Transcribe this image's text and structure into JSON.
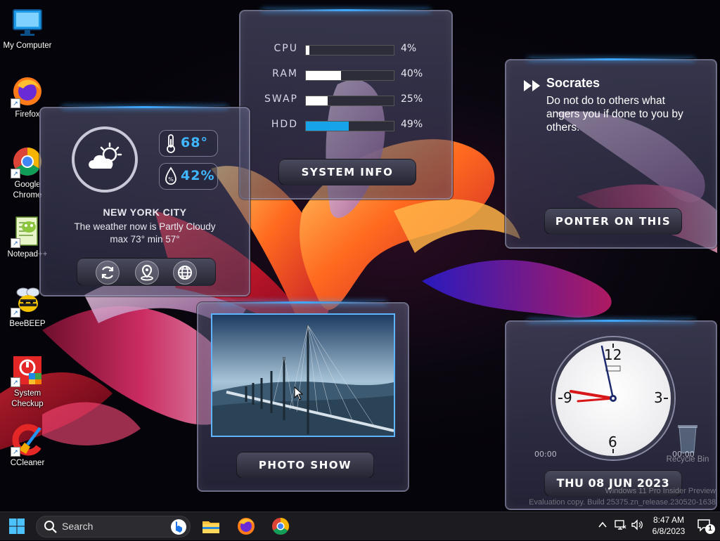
{
  "desktop_icons": [
    {
      "label": "My Computer",
      "icon": "monitor-icon"
    },
    {
      "label": "Firefox",
      "icon": "firefox-icon"
    },
    {
      "label": "Google Chrome",
      "icon": "chrome-icon"
    },
    {
      "label": "Notepad++",
      "icon": "notepadpp-icon"
    },
    {
      "label": "BeeBEEP",
      "icon": "bee-icon"
    },
    {
      "label": "System Checkup",
      "icon": "system-checkup-icon"
    },
    {
      "label": "CCleaner",
      "icon": "ccleaner-icon"
    }
  ],
  "system_info": {
    "rows": [
      {
        "label": "CPU",
        "value": "4%",
        "level": 0.04
      },
      {
        "label": "RAM",
        "value": "40%",
        "level": 0.4
      },
      {
        "label": "SWAP",
        "value": "25%",
        "level": 0.25
      },
      {
        "label": "HDD",
        "value": "49%",
        "level": 0.49
      }
    ],
    "button": "SYSTEM INFO"
  },
  "weather": {
    "temperature": "68°",
    "humidity": "42%",
    "city": "NEW YORK CITY",
    "condition_prefix": "The weather now is ",
    "condition": "Partly Cloudy",
    "range": "max 73° min 57°",
    "icons": [
      "refresh-icon",
      "location-pin-icon",
      "globe-icon"
    ]
  },
  "quote": {
    "author": "Socrates",
    "text": "Do not do to others what angers you if done to you by others.",
    "button": "PONTER ON THIS"
  },
  "photo": {
    "button": "PHOTO SHOW"
  },
  "clock": {
    "numerals": [
      "12",
      "3",
      "6",
      "9"
    ],
    "left_small": "00:00",
    "right_small": "00:00",
    "date": "THU 08 JUN 2023"
  },
  "desktop_extra": {
    "recycle_bin": "Recycle Bin",
    "watermark_line1": "Windows 11 Pro Insider Preview",
    "watermark_line2": "Evaluation copy. Build 25375.zn_release.230520-1638"
  },
  "taskbar": {
    "search_label": "Search",
    "time": "8:47 AM",
    "date": "6/8/2023",
    "notification_count": "1",
    "colors": {
      "accent": "#0078d4",
      "bar": "#1c1c20"
    }
  },
  "colors": {
    "bar_white": "#ffffff",
    "bar_hdd": "#16a3e8",
    "weather_accent": "#3fb8ff"
  }
}
